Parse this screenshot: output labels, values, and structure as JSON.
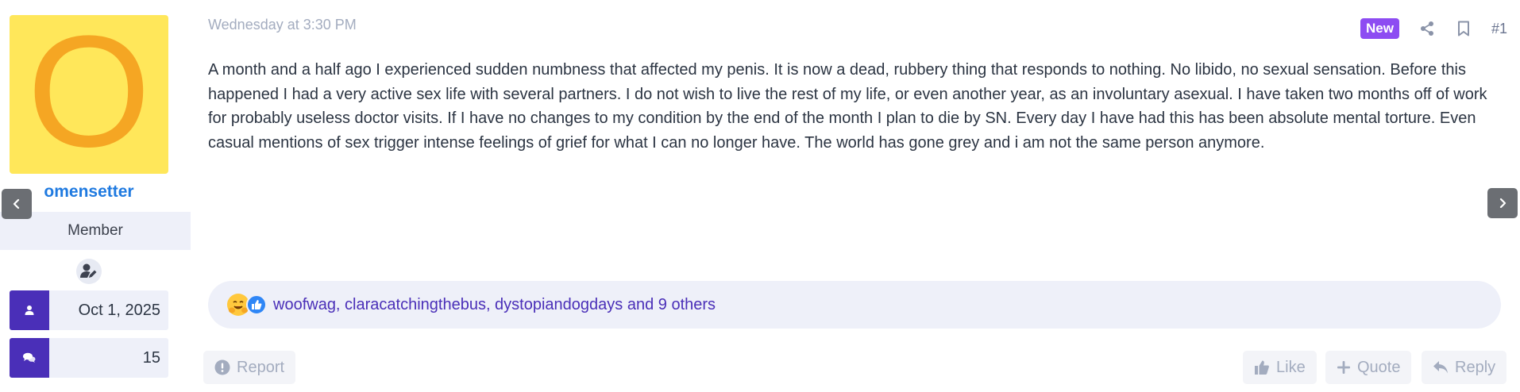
{
  "user": {
    "avatar_letter": "O",
    "username": "omensetter",
    "role": "Member",
    "joined": "Oct 1, 2025",
    "messages": "15"
  },
  "post": {
    "timestamp": "Wednesday at 3:30 PM",
    "badge": "New",
    "number": "#1",
    "body": "A month and a half ago I experienced sudden numbness that affected my penis. It is now a dead, rubbery thing that responds to nothing. No libido, no sexual sensation. Before this happened I had a very active sex life with several partners. I do not wish to live the rest of my life, or even another year, as an involuntary asexual. I have taken two months off of work for probably useless doctor visits. If I have no changes to my condition by the end of the month I plan to die by SN. Every day I have had this has been absolute mental torture. Even casual mentions of sex trigger intense feelings of grief for what I can no longer have. The world has gone grey and i am not the same person anymore."
  },
  "reactions": {
    "text": "woofwag, claracatchingthebus, dystopiandogdays and 9 others",
    "icons": [
      "hug-emoji-icon",
      "thumbs-up-icon"
    ]
  },
  "actions": {
    "report": "Report",
    "like": "Like",
    "quote": "Quote",
    "reply": "Reply"
  },
  "colors": {
    "accent": "#4a2fb8",
    "username": "#1f7ae0",
    "badge_new": "#8d4cf2",
    "avatar_bg": "#ffe75a",
    "avatar_letter": "#f5a623"
  }
}
